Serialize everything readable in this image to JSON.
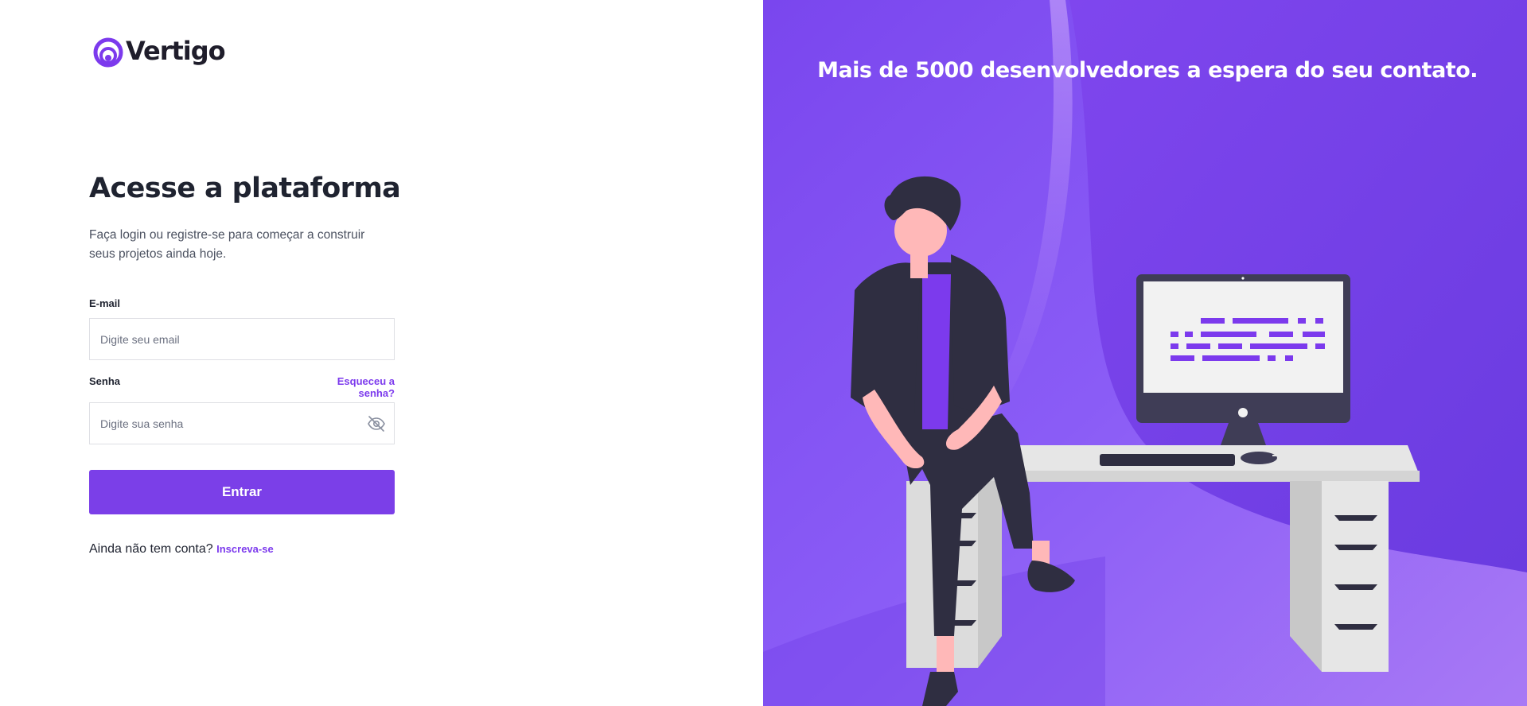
{
  "brand": {
    "name": "Vertigo",
    "logo_icon": "vertigo-swirl-icon",
    "accent": "#7c3aed"
  },
  "login": {
    "title": "Acesse a plataforma",
    "subtitle": "Faça login ou registre-se para começar a construir seus projetos ainda hoje.",
    "email": {
      "label": "E-mail",
      "placeholder": "Digite seu email",
      "value": ""
    },
    "password": {
      "label": "Senha",
      "placeholder": "Digite sua senha",
      "value": "",
      "toggle_icon": "eye-off-icon"
    },
    "forgot_label": "Esqueceu a senha?",
    "submit_label": "Entrar",
    "signup_prompt": "Ainda não tem conta?",
    "signup_link": "Inscreva-se"
  },
  "hero": {
    "headline": "Mais de 5000 desenvolvedores a espera do seu contato.",
    "background_color": "#7c3aed",
    "illustration": "developer-at-desk-illustration"
  }
}
